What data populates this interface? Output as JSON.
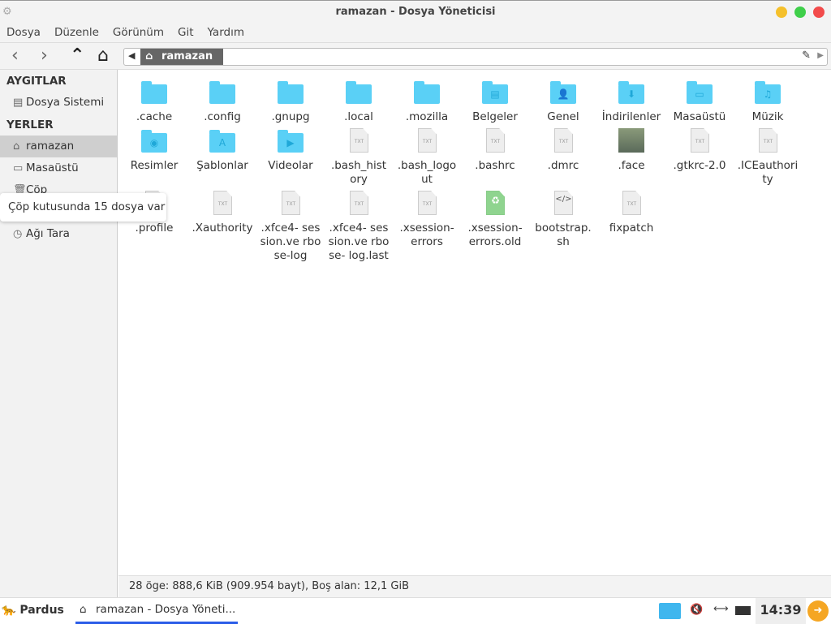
{
  "window": {
    "title": "ramazan - Dosya Yöneticisi",
    "controls": {
      "minimize": "#f5c02b",
      "maximize": "#3fcf4a",
      "close": "#f24b4b"
    }
  },
  "menu": [
    "Dosya",
    "Düzenle",
    "Görünüm",
    "Git",
    "Yardım"
  ],
  "path": {
    "current": "ramazan"
  },
  "sidebar": {
    "devices_header": "AYGITLAR",
    "devices": [
      {
        "label": "Dosya Sistemi",
        "icon": "drive-icon"
      }
    ],
    "places_header": "YERLER",
    "places": [
      {
        "label": "ramazan",
        "icon": "home-icon",
        "selected": true
      },
      {
        "label": "Masaüstü",
        "icon": "desktop-icon"
      },
      {
        "label": "Çöp",
        "icon": "trash-icon"
      },
      {
        "label": "Ağı Tara",
        "icon": "network-icon"
      }
    ],
    "tooltip": "Çöp kutusunda 15 dosya var"
  },
  "files": [
    {
      "name": ".cache",
      "type": "folder"
    },
    {
      "name": ".config",
      "type": "folder"
    },
    {
      "name": ".gnupg",
      "type": "folder"
    },
    {
      "name": ".local",
      "type": "folder"
    },
    {
      "name": ".mozilla",
      "type": "folder"
    },
    {
      "name": "Belgeler",
      "type": "folder",
      "glyph": "▤"
    },
    {
      "name": "Genel",
      "type": "folder",
      "glyph": "👤"
    },
    {
      "name": "İndirilenler",
      "type": "folder",
      "glyph": "⬇"
    },
    {
      "name": "Masaüstü",
      "type": "folder",
      "glyph": "▭"
    },
    {
      "name": "Müzik",
      "type": "folder",
      "glyph": "♫"
    },
    {
      "name": "Resimler",
      "type": "folder",
      "glyph": "◉"
    },
    {
      "name": "Şablonlar",
      "type": "folder",
      "glyph": "A"
    },
    {
      "name": "Videolar",
      "type": "folder",
      "glyph": "▶"
    },
    {
      "name": ".bash_hist ory",
      "type": "text"
    },
    {
      "name": ".bash_logo ut",
      "type": "text"
    },
    {
      "name": ".bashrc",
      "type": "text"
    },
    {
      "name": ".dmrc",
      "type": "text"
    },
    {
      "name": ".face",
      "type": "image"
    },
    {
      "name": ".gtkrc-2.0",
      "type": "text"
    },
    {
      "name": ".ICEauthori ty",
      "type": "text"
    },
    {
      "name": ".profile",
      "type": "text"
    },
    {
      "name": ".Xauthority",
      "type": "text"
    },
    {
      "name": ".xfce4- session.ve rbose-log",
      "type": "text"
    },
    {
      "name": ".xfce4- session.ve rbose- log.last",
      "type": "text"
    },
    {
      "name": ".xsession- errors",
      "type": "text"
    },
    {
      "name": ".xsession- errors.old",
      "type": "recycle"
    },
    {
      "name": "bootstrap. sh",
      "type": "script"
    },
    {
      "name": "fixpatch",
      "type": "text"
    }
  ],
  "file_badge": "TXT",
  "status": "28 öge: 888,6 KiB (909.954 bayt), Boş alan: 12,1 GiB",
  "taskbar": {
    "start": "Pardus",
    "task": "ramazan - Dosya Yöneti...",
    "clock": "14:39"
  }
}
